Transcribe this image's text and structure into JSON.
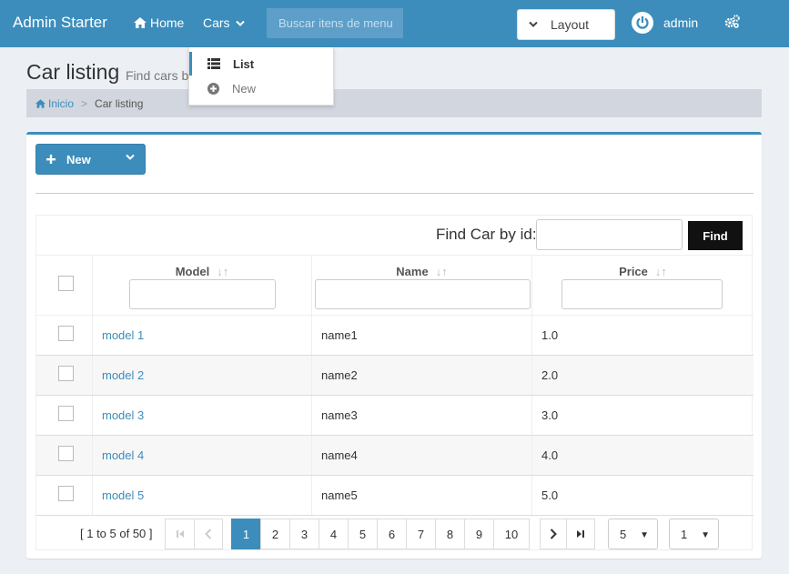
{
  "navbar": {
    "brand": "Admin Starter",
    "home_label": "Home",
    "cars_label": "Cars",
    "search_placeholder": "Buscar itens de menu",
    "layout_label": "Layout",
    "user_name": "admin"
  },
  "cars_menu": {
    "items": [
      {
        "label": "List",
        "icon": "list-icon"
      },
      {
        "label": "New",
        "icon": "plus-circle-icon"
      }
    ]
  },
  "page": {
    "title": "Car listing",
    "subtitle": "Find cars by"
  },
  "breadcrumb": {
    "home": "Inicio",
    "current": "Car listing"
  },
  "toolbar": {
    "new_label": "New"
  },
  "find": {
    "label": "Find Car by id:",
    "value": "",
    "button_label": "Find"
  },
  "table": {
    "columns": [
      {
        "label": "Model"
      },
      {
        "label": "Name"
      },
      {
        "label": "Price"
      }
    ],
    "rows": [
      {
        "model": "model 1",
        "name": "name1",
        "price": "1.0"
      },
      {
        "model": "model 2",
        "name": "name2",
        "price": "2.0"
      },
      {
        "model": "model 3",
        "name": "name3",
        "price": "3.0"
      },
      {
        "model": "model 4",
        "name": "name4",
        "price": "4.0"
      },
      {
        "model": "model 5",
        "name": "name5",
        "price": "5.0"
      }
    ]
  },
  "paginator": {
    "summary": "[ 1 to 5 of 50 ]",
    "pages": [
      "1",
      "2",
      "3",
      "4",
      "5",
      "6",
      "7",
      "8",
      "9",
      "10"
    ],
    "current_page": "1",
    "rows_per_page": "5",
    "jump_page": "1"
  },
  "colors": {
    "primary": "#3c8dbc",
    "background": "#ecf0f5",
    "breadcrumb_bg": "#d2d6de",
    "find_button": "#111111"
  }
}
